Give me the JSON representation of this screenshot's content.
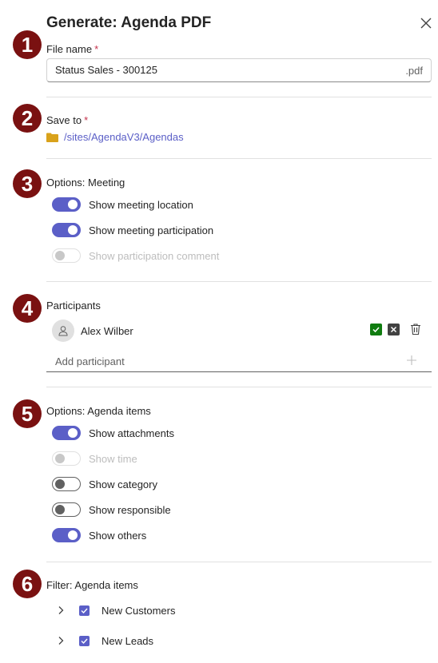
{
  "dialog": {
    "title": "Generate: Agenda PDF"
  },
  "badges": [
    "1",
    "2",
    "3",
    "4",
    "5",
    "6"
  ],
  "file": {
    "label": "File name",
    "required_mark": "*",
    "value": "Status Sales - 300125",
    "suffix": ".pdf"
  },
  "save_to": {
    "label": "Save to",
    "required_mark": "*",
    "path": "/sites/AgendaV3/Agendas"
  },
  "meeting_options": {
    "label": "Options: Meeting",
    "toggles": [
      {
        "label": "Show meeting location",
        "state": "on"
      },
      {
        "label": "Show meeting participation",
        "state": "on"
      },
      {
        "label": "Show participation comment",
        "state": "disabled"
      }
    ]
  },
  "participants": {
    "label": "Participants",
    "items": [
      {
        "name": "Alex Wilber"
      }
    ],
    "add_placeholder": "Add participant"
  },
  "agenda_options": {
    "label": "Options: Agenda items",
    "toggles": [
      {
        "label": "Show attachments",
        "state": "on"
      },
      {
        "label": "Show time",
        "state": "disabled"
      },
      {
        "label": "Show category",
        "state": "off"
      },
      {
        "label": "Show responsible",
        "state": "off"
      },
      {
        "label": "Show others",
        "state": "on"
      }
    ]
  },
  "filter": {
    "label": "Filter: Agenda items",
    "items": [
      {
        "label": "New Customers",
        "checked": true
      },
      {
        "label": "New Leads",
        "checked": true
      }
    ]
  },
  "colors": {
    "accent": "#5b5fc7",
    "badge": "#7a1111",
    "required": "#c4314b",
    "accept": "#107c10",
    "folder": "#d9a21b"
  }
}
